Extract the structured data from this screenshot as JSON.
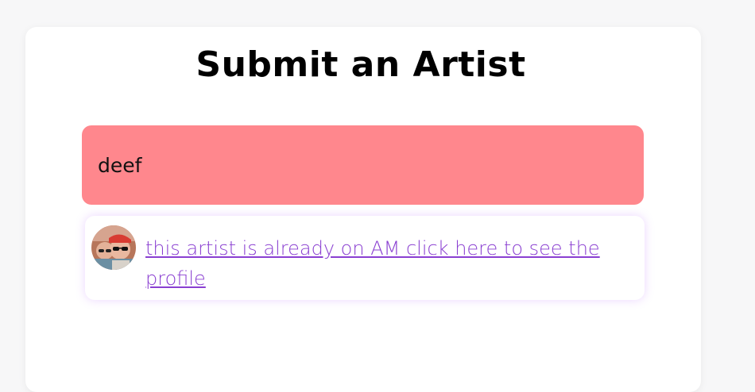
{
  "header": {
    "title": "Submit an Artist"
  },
  "form": {
    "artist_input_value": "deef"
  },
  "suggestion": {
    "link_text": "this artist is already on AM click here to see the profile",
    "avatar_icon": "user-avatar"
  },
  "colors": {
    "input_error_bg": "#ff878d",
    "link": "#8a3fd1"
  }
}
